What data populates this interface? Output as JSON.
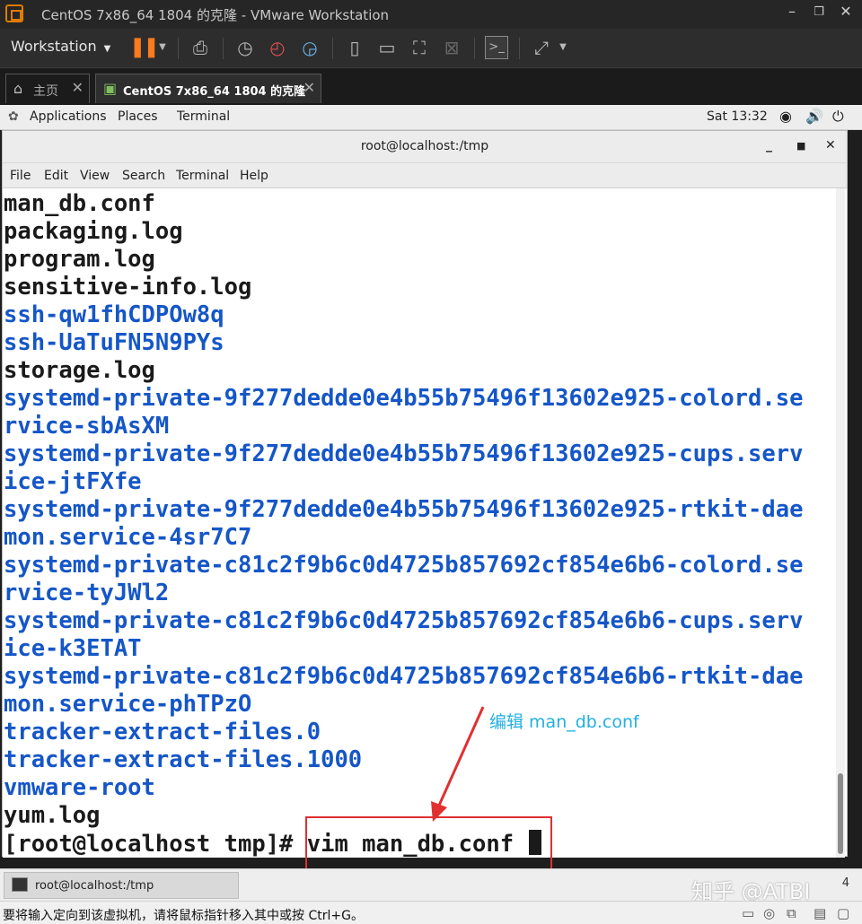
{
  "vmware": {
    "title": "CentOS 7x86_64 1804 的克隆 - VMware Workstation",
    "menu_label": "Workstation",
    "tabs": [
      {
        "label": "主页"
      },
      {
        "label": "CentOS 7x86_64 1804 的克隆"
      }
    ]
  },
  "gnome": {
    "applications": "Applications",
    "places": "Places",
    "terminal": "Terminal",
    "clock": "Sat 13:32"
  },
  "terminal": {
    "title": "root@localhost:/tmp",
    "menu": [
      "File",
      "Edit",
      "View",
      "Search",
      "Terminal",
      "Help"
    ],
    "lines": [
      {
        "text": "man_db.conf",
        "color": "black"
      },
      {
        "text": "packaging.log",
        "color": "black"
      },
      {
        "text": "program.log",
        "color": "black"
      },
      {
        "text": "sensitive-info.log",
        "color": "black"
      },
      {
        "text": "ssh-qw1fhCDPOw8q",
        "color": "blue"
      },
      {
        "text": "ssh-UaTuFN5N9PYs",
        "color": "blue"
      },
      {
        "text": "storage.log",
        "color": "black"
      },
      {
        "text": "systemd-private-9f277dedde0e4b55b75496f13602e925-colord.se",
        "color": "blue"
      },
      {
        "text": "rvice-sbAsXM",
        "color": "blue"
      },
      {
        "text": "systemd-private-9f277dedde0e4b55b75496f13602e925-cups.serv",
        "color": "blue"
      },
      {
        "text": "ice-jtFXfe",
        "color": "blue"
      },
      {
        "text": "systemd-private-9f277dedde0e4b55b75496f13602e925-rtkit-dae",
        "color": "blue"
      },
      {
        "text": "mon.service-4sr7C7",
        "color": "blue"
      },
      {
        "text": "systemd-private-c81c2f9b6c0d4725b857692cf854e6b6-colord.se",
        "color": "blue"
      },
      {
        "text": "rvice-tyJWl2",
        "color": "blue"
      },
      {
        "text": "systemd-private-c81c2f9b6c0d4725b857692cf854e6b6-cups.serv",
        "color": "blue"
      },
      {
        "text": "ice-k3ETAT",
        "color": "blue"
      },
      {
        "text": "systemd-private-c81c2f9b6c0d4725b857692cf854e6b6-rtkit-dae",
        "color": "blue"
      },
      {
        "text": "mon.service-phTPzO",
        "color": "blue"
      },
      {
        "text": "tracker-extract-files.0",
        "color": "blue"
      },
      {
        "text": "tracker-extract-files.1000",
        "color": "blue"
      },
      {
        "text": "vmware-root",
        "color": "blue"
      },
      {
        "text": "yum.log",
        "color": "black"
      }
    ],
    "prompt": "[root@localhost tmp]# ",
    "command": "vim man_db.conf "
  },
  "annotation": {
    "text": "编辑 man_db.conf",
    "color": "#23b0e0",
    "box_color": "#e03030"
  },
  "taskbar": {
    "task_label": "root@localhost:/tmp",
    "page": "4"
  },
  "watermark": "知乎 @ATBI",
  "statusbar": {
    "text": "要将输入定向到该虚拟机，请将鼠标指针移入其中或按 Ctrl+G。"
  },
  "colors": {
    "terminal_blue": "#1556c8",
    "terminal_black": "#1a1a1a",
    "pause_orange": "#ff7a1a"
  }
}
